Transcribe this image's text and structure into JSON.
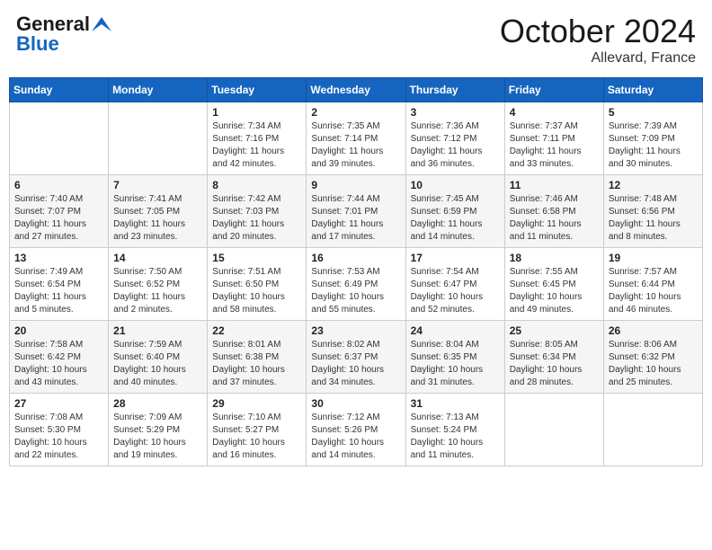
{
  "header": {
    "logo_line1": "General",
    "logo_line2": "Blue",
    "month": "October 2024",
    "location": "Allevard, France"
  },
  "weekdays": [
    "Sunday",
    "Monday",
    "Tuesday",
    "Wednesday",
    "Thursday",
    "Friday",
    "Saturday"
  ],
  "weeks": [
    [
      {
        "day": "",
        "info": ""
      },
      {
        "day": "",
        "info": ""
      },
      {
        "day": "1",
        "info": "Sunrise: 7:34 AM\nSunset: 7:16 PM\nDaylight: 11 hours and 42 minutes."
      },
      {
        "day": "2",
        "info": "Sunrise: 7:35 AM\nSunset: 7:14 PM\nDaylight: 11 hours and 39 minutes."
      },
      {
        "day": "3",
        "info": "Sunrise: 7:36 AM\nSunset: 7:12 PM\nDaylight: 11 hours and 36 minutes."
      },
      {
        "day": "4",
        "info": "Sunrise: 7:37 AM\nSunset: 7:11 PM\nDaylight: 11 hours and 33 minutes."
      },
      {
        "day": "5",
        "info": "Sunrise: 7:39 AM\nSunset: 7:09 PM\nDaylight: 11 hours and 30 minutes."
      }
    ],
    [
      {
        "day": "6",
        "info": "Sunrise: 7:40 AM\nSunset: 7:07 PM\nDaylight: 11 hours and 27 minutes."
      },
      {
        "day": "7",
        "info": "Sunrise: 7:41 AM\nSunset: 7:05 PM\nDaylight: 11 hours and 23 minutes."
      },
      {
        "day": "8",
        "info": "Sunrise: 7:42 AM\nSunset: 7:03 PM\nDaylight: 11 hours and 20 minutes."
      },
      {
        "day": "9",
        "info": "Sunrise: 7:44 AM\nSunset: 7:01 PM\nDaylight: 11 hours and 17 minutes."
      },
      {
        "day": "10",
        "info": "Sunrise: 7:45 AM\nSunset: 6:59 PM\nDaylight: 11 hours and 14 minutes."
      },
      {
        "day": "11",
        "info": "Sunrise: 7:46 AM\nSunset: 6:58 PM\nDaylight: 11 hours and 11 minutes."
      },
      {
        "day": "12",
        "info": "Sunrise: 7:48 AM\nSunset: 6:56 PM\nDaylight: 11 hours and 8 minutes."
      }
    ],
    [
      {
        "day": "13",
        "info": "Sunrise: 7:49 AM\nSunset: 6:54 PM\nDaylight: 11 hours and 5 minutes."
      },
      {
        "day": "14",
        "info": "Sunrise: 7:50 AM\nSunset: 6:52 PM\nDaylight: 11 hours and 2 minutes."
      },
      {
        "day": "15",
        "info": "Sunrise: 7:51 AM\nSunset: 6:50 PM\nDaylight: 10 hours and 58 minutes."
      },
      {
        "day": "16",
        "info": "Sunrise: 7:53 AM\nSunset: 6:49 PM\nDaylight: 10 hours and 55 minutes."
      },
      {
        "day": "17",
        "info": "Sunrise: 7:54 AM\nSunset: 6:47 PM\nDaylight: 10 hours and 52 minutes."
      },
      {
        "day": "18",
        "info": "Sunrise: 7:55 AM\nSunset: 6:45 PM\nDaylight: 10 hours and 49 minutes."
      },
      {
        "day": "19",
        "info": "Sunrise: 7:57 AM\nSunset: 6:44 PM\nDaylight: 10 hours and 46 minutes."
      }
    ],
    [
      {
        "day": "20",
        "info": "Sunrise: 7:58 AM\nSunset: 6:42 PM\nDaylight: 10 hours and 43 minutes."
      },
      {
        "day": "21",
        "info": "Sunrise: 7:59 AM\nSunset: 6:40 PM\nDaylight: 10 hours and 40 minutes."
      },
      {
        "day": "22",
        "info": "Sunrise: 8:01 AM\nSunset: 6:38 PM\nDaylight: 10 hours and 37 minutes."
      },
      {
        "day": "23",
        "info": "Sunrise: 8:02 AM\nSunset: 6:37 PM\nDaylight: 10 hours and 34 minutes."
      },
      {
        "day": "24",
        "info": "Sunrise: 8:04 AM\nSunset: 6:35 PM\nDaylight: 10 hours and 31 minutes."
      },
      {
        "day": "25",
        "info": "Sunrise: 8:05 AM\nSunset: 6:34 PM\nDaylight: 10 hours and 28 minutes."
      },
      {
        "day": "26",
        "info": "Sunrise: 8:06 AM\nSunset: 6:32 PM\nDaylight: 10 hours and 25 minutes."
      }
    ],
    [
      {
        "day": "27",
        "info": "Sunrise: 7:08 AM\nSunset: 5:30 PM\nDaylight: 10 hours and 22 minutes."
      },
      {
        "day": "28",
        "info": "Sunrise: 7:09 AM\nSunset: 5:29 PM\nDaylight: 10 hours and 19 minutes."
      },
      {
        "day": "29",
        "info": "Sunrise: 7:10 AM\nSunset: 5:27 PM\nDaylight: 10 hours and 16 minutes."
      },
      {
        "day": "30",
        "info": "Sunrise: 7:12 AM\nSunset: 5:26 PM\nDaylight: 10 hours and 14 minutes."
      },
      {
        "day": "31",
        "info": "Sunrise: 7:13 AM\nSunset: 5:24 PM\nDaylight: 10 hours and 11 minutes."
      },
      {
        "day": "",
        "info": ""
      },
      {
        "day": "",
        "info": ""
      }
    ]
  ]
}
